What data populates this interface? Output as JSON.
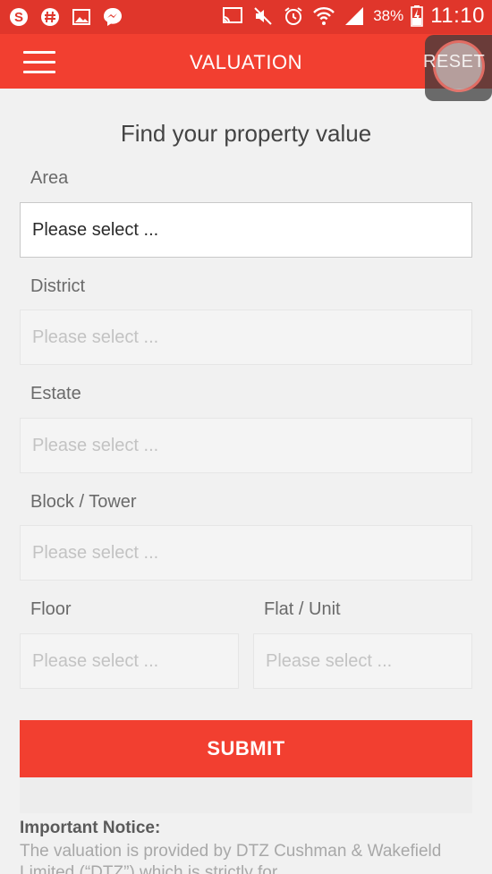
{
  "status_bar": {
    "icons": [
      "skype-icon",
      "hash-app-icon",
      "gallery-icon",
      "messenger-icon",
      "cast-icon",
      "mute-icon",
      "alarm-icon",
      "wifi-icon",
      "signal-icon",
      "battery-charging-icon"
    ],
    "battery_percent": "38%",
    "time": "11:10"
  },
  "app_bar": {
    "title": "VALUATION",
    "reset_label": "RESET"
  },
  "form": {
    "heading": "Find your property value",
    "area": {
      "label": "Area",
      "value": "Please select ..."
    },
    "district": {
      "label": "District",
      "placeholder": "Please select ..."
    },
    "estate": {
      "label": "Estate",
      "placeholder": "Please select ..."
    },
    "block": {
      "label": "Block / Tower",
      "placeholder": "Please select ..."
    },
    "floor": {
      "label": "Floor",
      "placeholder": "Please select ..."
    },
    "flat": {
      "label": "Flat / Unit",
      "placeholder": "Please select ..."
    },
    "submit_label": "SUBMIT"
  },
  "notice": {
    "title": "Important Notice:",
    "body": "The valuation is provided by DTZ Cushman & Wakefield Limited (“DTZ”) which is strictly for"
  },
  "colors": {
    "status_bar": "#e0362b",
    "primary": "#f23f30",
    "background": "#f1f1f1"
  }
}
